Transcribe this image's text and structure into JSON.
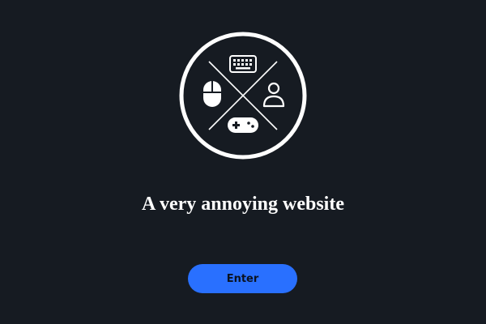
{
  "page": {
    "title": "A very annoying website",
    "enter_label": "Enter"
  },
  "logo": {
    "icons": [
      "keyboard-icon",
      "mouse-icon",
      "user-icon",
      "gamepad-icon"
    ]
  },
  "colors": {
    "background": "#161b22",
    "accent": "#2970ff",
    "text": "#ffffff"
  }
}
